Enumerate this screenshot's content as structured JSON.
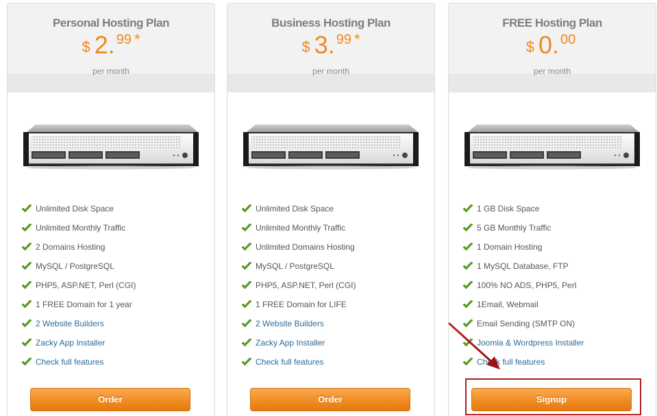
{
  "plans": [
    {
      "title": "Personal Hosting Plan",
      "currency": "$",
      "price_int": "2.",
      "price_dec": "99",
      "price_mark": "*",
      "period": "per month",
      "features": [
        {
          "label": "Unlimited Disk Space",
          "link": false
        },
        {
          "label": "Unlimited Monthly Traffic",
          "link": false
        },
        {
          "label": "2 Domains Hosting",
          "link": false
        },
        {
          "label": "MySQL / PostgreSQL",
          "link": false
        },
        {
          "label": "PHP5, ASP.NET, Perl (CGI)",
          "link": false
        },
        {
          "label": "1 FREE Domain for 1 year",
          "link": false
        },
        {
          "label": "2 Website Builders",
          "link": true
        },
        {
          "label": "Zacky App Installer",
          "link": true
        },
        {
          "label": "Check full features",
          "link": true
        }
      ],
      "button_label": "Order"
    },
    {
      "title": "Business Hosting Plan",
      "currency": "$",
      "price_int": "3.",
      "price_dec": "99",
      "price_mark": "*",
      "period": "per month",
      "features": [
        {
          "label": "Unlimited Disk Space",
          "link": false
        },
        {
          "label": "Unlimited Monthly Traffic",
          "link": false
        },
        {
          "label": "Unlimited Domains Hosting",
          "link": false
        },
        {
          "label": "MySQL / PostgreSQL",
          "link": false
        },
        {
          "label": "PHP5, ASP.NET, Perl (CGI)",
          "link": false
        },
        {
          "label": "1 FREE Domain for LIFE",
          "link": false
        },
        {
          "label": "2 Website Builders",
          "link": true
        },
        {
          "label": "Zacky App Installer",
          "link": true
        },
        {
          "label": "Check full features",
          "link": true
        }
      ],
      "button_label": "Order"
    },
    {
      "title": "FREE Hosting Plan",
      "currency": "$",
      "price_int": "0.",
      "price_dec": "00",
      "price_mark": "",
      "period": "per month",
      "features": [
        {
          "label": "1 GB Disk Space",
          "link": false
        },
        {
          "label": "5 GB Monthly Traffic",
          "link": false
        },
        {
          "label": "1 Domain Hosting",
          "link": false
        },
        {
          "label": "1 MySQL Database, FTP",
          "link": false
        },
        {
          "label": "100% NO ADS, PHP5, Perl",
          "link": false
        },
        {
          "label": "1Email, Webmail",
          "link": false
        },
        {
          "label": "Email Sending (SMTP ON)",
          "link": false
        },
        {
          "label": "Joomla & Wordpress Installer",
          "link": true
        },
        {
          "label": "Check full features",
          "link": true
        }
      ],
      "button_label": "Signup"
    }
  ],
  "colors": {
    "accent": "#ee8a20",
    "link": "#2b6b9a",
    "check": "#5aa51c",
    "highlight": "#b01e1e"
  },
  "icons": {
    "feature": "check-icon",
    "product": "server-rack-image",
    "annotation": "red-arrow-icon"
  }
}
